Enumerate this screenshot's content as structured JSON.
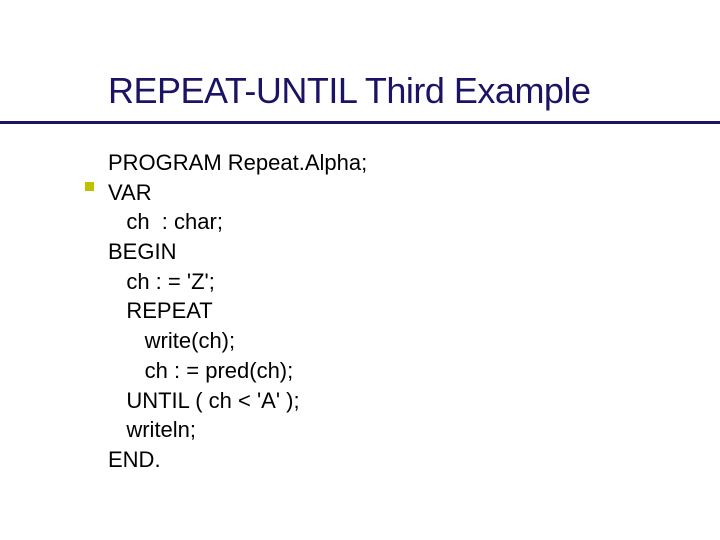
{
  "title": "REPEAT-UNTIL Third Example",
  "code": {
    "l1": "PROGRAM Repeat.Alpha;",
    "l2": "VAR",
    "l3": "   ch  : char;",
    "l4": "BEGIN",
    "l5": "   ch : = 'Z';",
    "l6": "   REPEAT",
    "l7": "      write(ch);",
    "l8": "      ch : = pred(ch);",
    "l9": "   UNTIL ( ch < 'A' );",
    "l10": "   writeln;",
    "l11": "END."
  }
}
